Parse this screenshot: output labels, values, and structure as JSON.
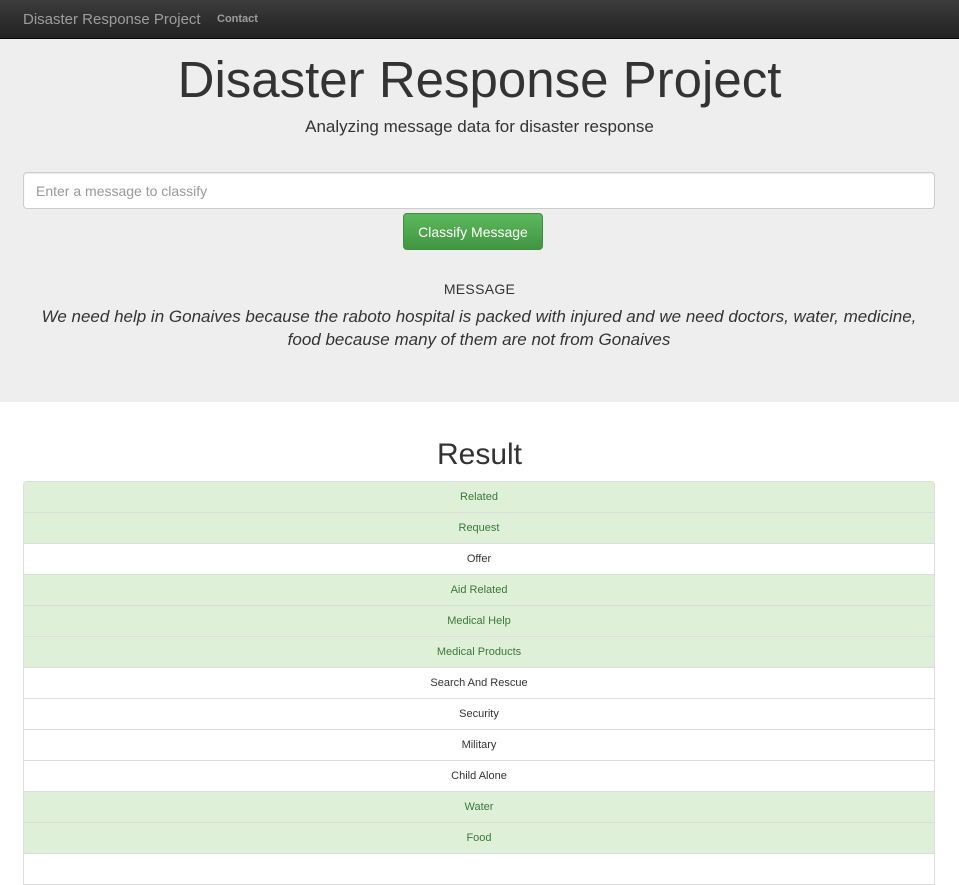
{
  "navbar": {
    "brand": "Disaster Response Project",
    "links": [
      "Contact"
    ]
  },
  "jumbotron": {
    "title": "Disaster Response Project",
    "subtitle": "Analyzing message data for disaster response",
    "input_placeholder": "Enter a message to classify",
    "button_label": "Classify Message",
    "message_heading": "MESSAGE",
    "message_text": "We need help in Gonaives because the raboto hospital is packed with injured and we need doctors, water, medicine, food because many of them are not from Gonaives"
  },
  "result": {
    "heading": "Result",
    "categories": [
      {
        "label": "Related",
        "positive": true
      },
      {
        "label": "Request",
        "positive": true
      },
      {
        "label": "Offer",
        "positive": false
      },
      {
        "label": "Aid Related",
        "positive": true
      },
      {
        "label": "Medical Help",
        "positive": true
      },
      {
        "label": "Medical Products",
        "positive": true
      },
      {
        "label": "Search And Rescue",
        "positive": false
      },
      {
        "label": "Security",
        "positive": false
      },
      {
        "label": "Military",
        "positive": false
      },
      {
        "label": "Child Alone",
        "positive": false
      },
      {
        "label": "Water",
        "positive": true
      },
      {
        "label": "Food",
        "positive": true
      },
      {
        "label": "",
        "positive": false
      }
    ]
  },
  "colors": {
    "positive_bg": "#dff0d8",
    "positive_text": "#3c763d",
    "button_green": "#5cb85c",
    "navbar_bg": "#222222",
    "jumbotron_bg": "#eeeeee"
  }
}
